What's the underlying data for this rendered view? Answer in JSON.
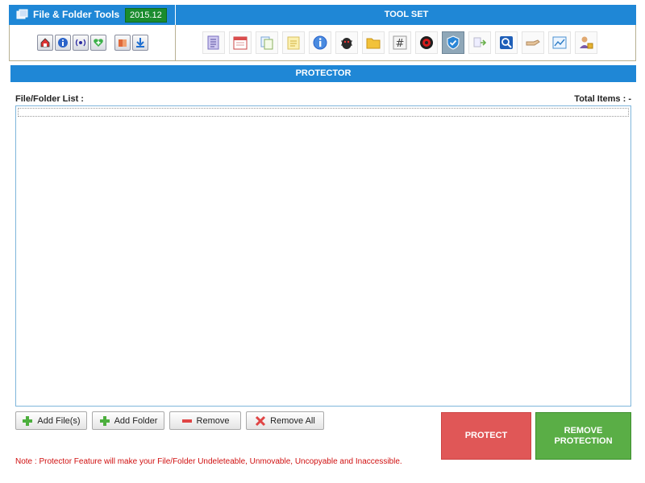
{
  "header": {
    "app_title": "File & Folder Tools",
    "version": "2015.12",
    "toolset_label": "TOOL SET"
  },
  "left_buttons": [
    {
      "name": "home-icon"
    },
    {
      "name": "info-icon"
    },
    {
      "name": "broadcast-icon"
    },
    {
      "name": "heart-plus-icon"
    },
    {
      "name": "puzzle-icon"
    },
    {
      "name": "download-icon"
    }
  ],
  "tools": [
    {
      "name": "document-list-icon"
    },
    {
      "name": "calendar-icon"
    },
    {
      "name": "copy-files-icon"
    },
    {
      "name": "notepad-icon"
    },
    {
      "name": "info-circle-icon"
    },
    {
      "name": "bug-icon"
    },
    {
      "name": "folder-icon"
    },
    {
      "name": "hash-icon"
    },
    {
      "name": "virus-icon"
    },
    {
      "name": "shield-icon",
      "active": true
    },
    {
      "name": "file-move-icon"
    },
    {
      "name": "search-icon"
    },
    {
      "name": "hand-icon"
    },
    {
      "name": "chart-image-icon"
    },
    {
      "name": "user-lock-icon"
    }
  ],
  "section": {
    "title": "PROTECTOR",
    "list_label": "File/Folder List :",
    "total_label": "Total Items : -"
  },
  "actions": {
    "add_files": "Add File(s)",
    "add_folder": "Add Folder",
    "remove": "Remove",
    "remove_all": "Remove All",
    "protect": "PROTECT",
    "remove_protection_line1": "REMOVE",
    "remove_protection_line2": "PROTECTION"
  },
  "note": "Note : Protector Feature will make your File/Folder Undeleteable, Unmovable, Uncopyable and Inaccessible.",
  "colors": {
    "header_blue": "#1f87d6",
    "protect_red": "#e05757",
    "remove_green": "#5aae46",
    "note_red": "#d01010"
  }
}
